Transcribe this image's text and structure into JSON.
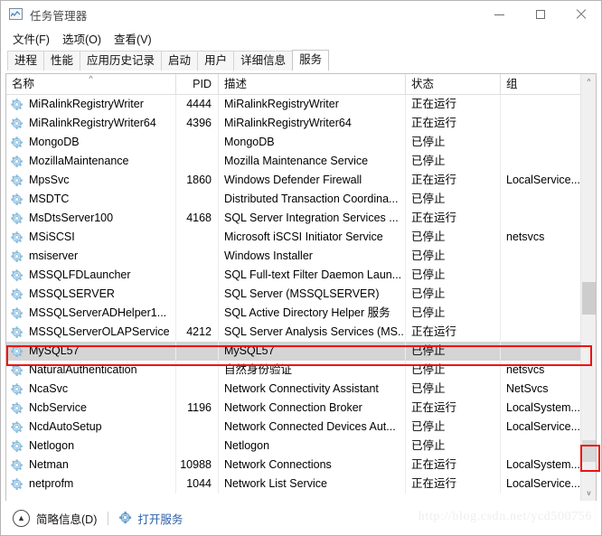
{
  "window": {
    "title": "任务管理器",
    "icon": "task-manager-icon",
    "minimize_label": "—",
    "maximize_label": "□",
    "close_label": "✕"
  },
  "menu": {
    "items": [
      {
        "label": "文件(F)"
      },
      {
        "label": "选项(O)"
      },
      {
        "label": "查看(V)"
      }
    ]
  },
  "tabs": [
    {
      "label": "进程",
      "active": false
    },
    {
      "label": "性能",
      "active": false
    },
    {
      "label": "应用历史记录",
      "active": false
    },
    {
      "label": "启动",
      "active": false
    },
    {
      "label": "用户",
      "active": false
    },
    {
      "label": "详细信息",
      "active": false
    },
    {
      "label": "服务",
      "active": true
    }
  ],
  "table": {
    "columns": [
      {
        "key": "name",
        "label": "名称",
        "sorted": true,
        "sort_indicator": "^"
      },
      {
        "key": "pid",
        "label": "PID"
      },
      {
        "key": "desc",
        "label": "描述"
      },
      {
        "key": "status",
        "label": "状态"
      },
      {
        "key": "group",
        "label": "组"
      }
    ],
    "rows": [
      {
        "name": "MiRalinkRegistryWriter",
        "pid": "4444",
        "desc": "MiRalinkRegistryWriter",
        "status": "正在运行",
        "group": ""
      },
      {
        "name": "MiRalinkRegistryWriter64",
        "pid": "4396",
        "desc": "MiRalinkRegistryWriter64",
        "status": "正在运行",
        "group": ""
      },
      {
        "name": "MongoDB",
        "pid": "",
        "desc": "MongoDB",
        "status": "已停止",
        "group": ""
      },
      {
        "name": "MozillaMaintenance",
        "pid": "",
        "desc": "Mozilla Maintenance Service",
        "status": "已停止",
        "group": ""
      },
      {
        "name": "MpsSvc",
        "pid": "1860",
        "desc": "Windows Defender Firewall",
        "status": "正在运行",
        "group": "LocalService..."
      },
      {
        "name": "MSDTC",
        "pid": "",
        "desc": "Distributed Transaction Coordina...",
        "status": "已停止",
        "group": ""
      },
      {
        "name": "MsDtsServer100",
        "pid": "4168",
        "desc": "SQL Server Integration Services ...",
        "status": "正在运行",
        "group": ""
      },
      {
        "name": "MSiSCSI",
        "pid": "",
        "desc": "Microsoft iSCSI Initiator Service",
        "status": "已停止",
        "group": "netsvcs"
      },
      {
        "name": "msiserver",
        "pid": "",
        "desc": "Windows Installer",
        "status": "已停止",
        "group": ""
      },
      {
        "name": "MSSQLFDLauncher",
        "pid": "",
        "desc": "SQL Full-text Filter Daemon Laun...",
        "status": "已停止",
        "group": ""
      },
      {
        "name": "MSSQLSERVER",
        "pid": "",
        "desc": "SQL Server (MSSQLSERVER)",
        "status": "已停止",
        "group": ""
      },
      {
        "name": "MSSQLServerADHelper1...",
        "pid": "",
        "desc": "SQL Active Directory Helper 服务",
        "status": "已停止",
        "group": ""
      },
      {
        "name": "MSSQLServerOLAPService",
        "pid": "4212",
        "desc": "SQL Server Analysis Services (MS...",
        "status": "正在运行",
        "group": ""
      },
      {
        "name": "MySQL57",
        "pid": "",
        "desc": "MySQL57",
        "status": "已停止",
        "group": "",
        "selected": true,
        "highlighted": true
      },
      {
        "name": "NaturalAuthentication",
        "pid": "",
        "desc": "自然身份验证",
        "status": "已停止",
        "group": "netsvcs"
      },
      {
        "name": "NcaSvc",
        "pid": "",
        "desc": "Network Connectivity Assistant",
        "status": "已停止",
        "group": "NetSvcs"
      },
      {
        "name": "NcbService",
        "pid": "1196",
        "desc": "Network Connection Broker",
        "status": "正在运行",
        "group": "LocalSystem..."
      },
      {
        "name": "NcdAutoSetup",
        "pid": "",
        "desc": "Network Connected Devices Aut...",
        "status": "已停止",
        "group": "LocalService..."
      },
      {
        "name": "Netlogon",
        "pid": "",
        "desc": "Netlogon",
        "status": "已停止",
        "group": ""
      },
      {
        "name": "Netman",
        "pid": "10988",
        "desc": "Network Connections",
        "status": "正在运行",
        "group": "LocalSystem..."
      },
      {
        "name": "netprofm",
        "pid": "1044",
        "desc": "Network List Service",
        "status": "正在运行",
        "group": "LocalService..."
      }
    ]
  },
  "scrollbar": {
    "up_arrow": "^",
    "down_arrow": "v"
  },
  "statusbar": {
    "collapse_icon": "chevron-up-icon",
    "brief_label": "简略信息(D)",
    "open_services_label": "打开服务",
    "open_services_icon": "gear-icon"
  },
  "watermark": {
    "text": "http://blog.csdn.net/ycd500756"
  },
  "colors": {
    "accent_link": "#2b5ea8",
    "annotation": "#ee1111",
    "selection": "#d4d4d4",
    "gear_icon": "#7fb2d9"
  }
}
